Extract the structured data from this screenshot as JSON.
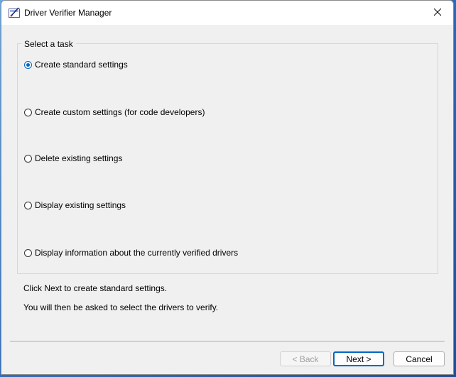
{
  "window": {
    "title": "Driver Verifier Manager",
    "app_icon": "driver-verifier-icon",
    "close_icon": "close-icon"
  },
  "group": {
    "label": "Select a task",
    "options": [
      {
        "label": "Create standard settings",
        "selected": true
      },
      {
        "label": "Create custom settings (for code developers)",
        "selected": false
      },
      {
        "label": "Delete existing settings",
        "selected": false
      },
      {
        "label": "Display existing settings",
        "selected": false
      },
      {
        "label": "Display information about the currently verified drivers",
        "selected": false
      }
    ]
  },
  "info": {
    "line1": "Click Next to create standard settings.",
    "line2": "You will then be asked to select the drivers to verify."
  },
  "buttons": {
    "back": "< Back",
    "next": "Next >",
    "cancel": "Cancel"
  },
  "colors": {
    "accent": "#0067c0",
    "window_bg": "#f0f0f0"
  }
}
